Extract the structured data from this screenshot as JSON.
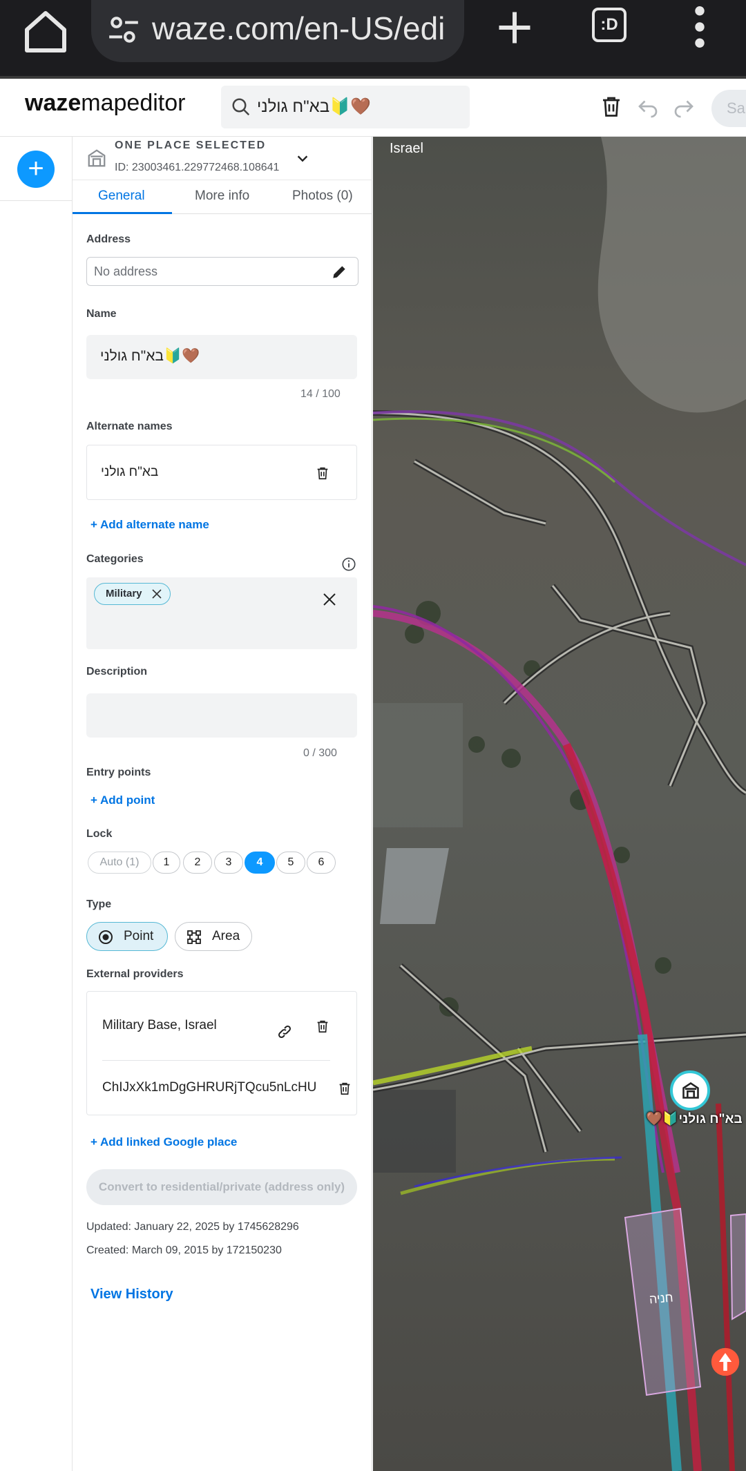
{
  "browser": {
    "url": "waze.com/en-US/edi",
    "tabs_label": ":D"
  },
  "header": {
    "logo_bold": "waze",
    "logo_rest": "mapeditor",
    "search_query": "בא\"ח גולני🔰🤎",
    "save_label": "Sa"
  },
  "panel": {
    "selection_title": "ONE PLACE SELECTED",
    "selection_id": "ID: 23003461.229772468.108641",
    "tabs": [
      "General",
      "More info",
      "Photos (0)"
    ],
    "address_label": "Address",
    "address_placeholder": "No address",
    "name_label": "Name",
    "name_value": "בא\"ח גולני🔰🤎",
    "name_counter": "14 / 100",
    "alt_names_label": "Alternate names",
    "alt_name": "בא\"ח גולני",
    "add_alt_name": "+ Add alternate name",
    "categories_label": "Categories",
    "category_chip": "Military",
    "description_label": "Description",
    "description_counter": "0 / 300",
    "entry_points_label": "Entry points",
    "add_point": "+ Add point",
    "lock_label": "Lock",
    "lock_levels": [
      "Auto (1)",
      "1",
      "2",
      "3",
      "4",
      "5",
      "6"
    ],
    "lock_selected": "4",
    "type_label": "Type",
    "type_point": "Point",
    "type_area": "Area",
    "ext_label": "External providers",
    "ext_provider_1": "Military Base, Israel",
    "ext_provider_2": "ChIJxXk1mDgGHRURjTQcu5nLcHU",
    "add_google": "+ Add linked Google place",
    "convert": "Convert to residential/private (address only)",
    "updated": "Updated: January 22, 2025 by 1745628296",
    "created": "Created: March 09, 2015 by 172150230",
    "view_history": "View History"
  },
  "map": {
    "country": "Israel",
    "place_label": "בא\"ח גולני🔰🤎",
    "parking_label": "חניה"
  },
  "colors": {
    "accent": "#0075e3",
    "fab": "#0d99ff",
    "chip_border": "#55b8d4"
  },
  "icons": [
    "home-icon",
    "tune-icon",
    "plus-icon",
    "more-vert-icon",
    "search-icon",
    "trash-icon",
    "undo-icon",
    "redo-icon",
    "place-icon",
    "chevron-down-icon",
    "pencil-icon",
    "info-icon",
    "close-icon",
    "radio-icon",
    "area-icon",
    "link-icon"
  ]
}
